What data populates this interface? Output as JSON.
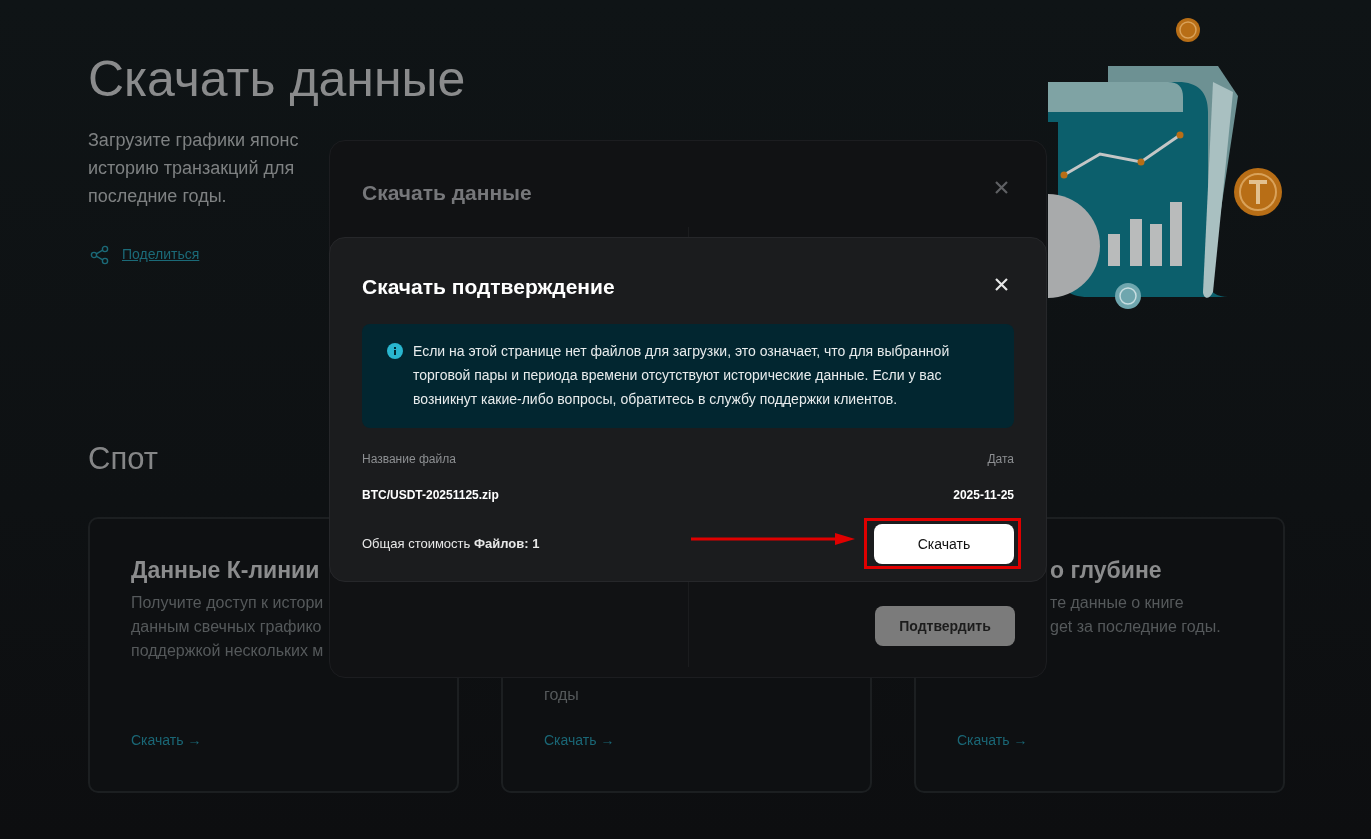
{
  "page": {
    "title": "Скачать данные",
    "description_lines": [
      "Загрузите графики японс",
      "историю транзакций для",
      "последние годы."
    ],
    "share_link": "Поделиться",
    "section_title": "Спот",
    "cards": [
      {
        "title": "Данные К-линии",
        "description_lines": [
          "Получите доступ к истори",
          "данным свечных графико",
          "поддержкой нескольких м"
        ],
        "link": "Скачать →",
        "kind": "open"
      },
      {
        "description_lines": [
          "годы"
        ],
        "link": "Скачать →",
        "kind": "top-hidden"
      },
      {
        "title": "о глубине",
        "description_lines": [
          "те данные о книге",
          "get за последние годы."
        ],
        "link": "Скачать →",
        "kind": "left-hidden"
      }
    ]
  },
  "download_modal": {
    "title": "Скачать данные",
    "confirm_button": "Подтвердить",
    "confirm_disabled": true
  },
  "confirm_modal": {
    "title": "Скачать подтверждение",
    "notice": "Если на этой странице нет файлов для загрузки, это означает, что для выбранной торговой пары и периода времени отсутствуют исторические данные. Если у вас возникнут какие-либо вопросы, обратитесь в службу поддержки клиентов.",
    "table": {
      "columns": [
        "Название файла",
        "Дата"
      ],
      "rows": [
        [
          "BTC/USDT-20251125.zip",
          "2025-11-25"
        ]
      ]
    },
    "total": "Общая стоимость **Файлов: 1**",
    "download_button": "Скачать",
    "highlighted": true
  }
}
